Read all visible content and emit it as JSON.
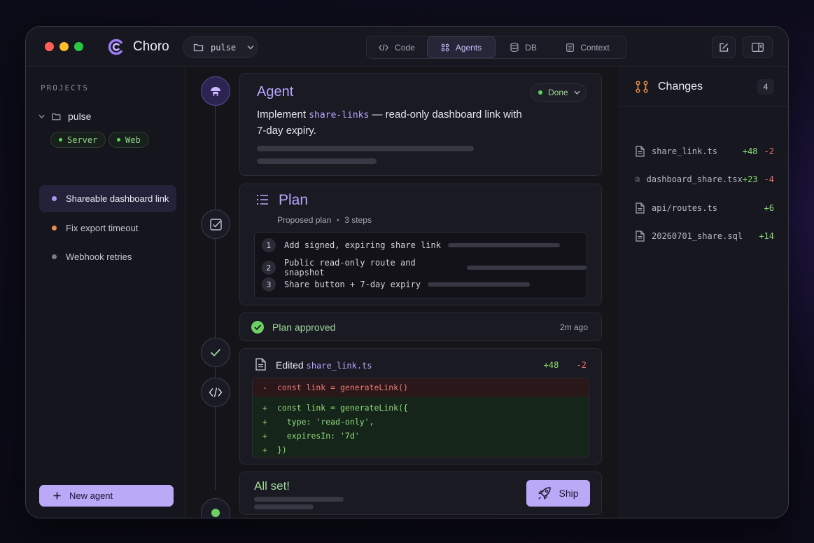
{
  "app": {
    "title": "Choro",
    "accent": "#b9a6ff"
  },
  "project_selector": {
    "value": "pulse"
  },
  "tabs": [
    {
      "label": "Code",
      "icon": "code-icon"
    },
    {
      "label": "Agents",
      "icon": "agents-icon",
      "active": true
    },
    {
      "label": "DB",
      "icon": "database-icon"
    },
    {
      "label": "Context",
      "icon": "context-icon"
    }
  ],
  "sidebar": {
    "heading": "PROJECTS",
    "project": "pulse",
    "services": [
      "Server",
      "Web"
    ],
    "items": [
      {
        "label": "Shareable dashboard link",
        "dot_color": "#a996f5",
        "active": true
      },
      {
        "label": "Fix export timeout",
        "dot_color": "#f2894a"
      },
      {
        "label": "Webhook retries",
        "dot_color": "#7a7a8c"
      }
    ],
    "new_agent_label": "New agent"
  },
  "agent": {
    "title": "Agent",
    "status": "Done",
    "desc_prefix": "Implement",
    "desc_code": "share-links",
    "desc_suffix": "— read-only dashboard link with 7-day expiry."
  },
  "plan": {
    "title": "Plan",
    "subtitle": "Proposed plan",
    "steps_count": "3 steps",
    "steps": [
      {
        "n": "1",
        "text": "Add signed, expiring share link"
      },
      {
        "n": "2",
        "text": "Public read-only route and snapshot"
      },
      {
        "n": "3",
        "text": "Share button + 7-day expiry"
      }
    ]
  },
  "approved": {
    "text": "Plan approved",
    "time": "2m ago"
  },
  "edit": {
    "title": "Edited",
    "file": "share_link.ts",
    "added": "+48",
    "removed": "-2",
    "diff_removed": {
      "sign": "-",
      "code": "const link = generateLink()"
    },
    "diff_added": [
      {
        "sign": "+",
        "code": "const link = generateLink({"
      },
      {
        "sign": "+",
        "code": "  type: 'read-only',"
      },
      {
        "sign": "+",
        "code": "  expiresIn: '7d'"
      },
      {
        "sign": "+",
        "code": "})"
      }
    ]
  },
  "done": {
    "text": "All set!",
    "ship_label": "Ship"
  },
  "changes": {
    "title": "Changes",
    "count": "4",
    "files": [
      {
        "name": "share_link.ts",
        "added": "+48",
        "removed": "-2"
      },
      {
        "name": "dashboard_share.tsx",
        "added": "+23",
        "removed": "-4"
      },
      {
        "name": "api/routes.ts",
        "added": "+6",
        "removed": ""
      },
      {
        "name": "20260701_share.sql",
        "added": "+14",
        "removed": ""
      }
    ]
  }
}
